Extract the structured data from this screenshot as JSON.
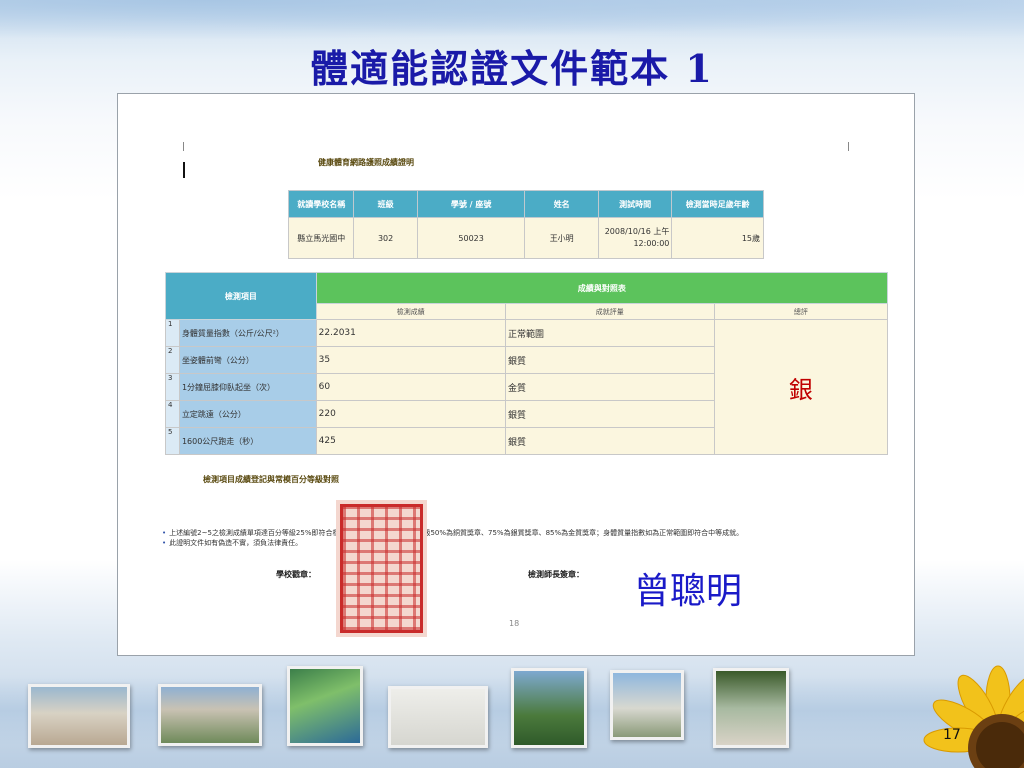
{
  "slide": {
    "title": "體適能認證文件範本 1",
    "slide_number": "17"
  },
  "document": {
    "title": "健康體育網路護照成績證明",
    "student_table": {
      "headers": [
        "就讀學校名稱",
        "班級",
        "學號 / 座號",
        "姓名",
        "測試時間",
        "檢測當時足歲年齡"
      ],
      "values": [
        "縣立馬光國中",
        "302",
        "50023",
        "王小明",
        "2008/10/16 上午 12:00:00",
        "15歲"
      ]
    },
    "results_table": {
      "item_header": "檢測項目",
      "score_header": "成績與對照表",
      "sub_headers": [
        "檢測成績",
        "成就評量",
        "總評"
      ],
      "rows": [
        {
          "no": "1",
          "item": "身體質量指數（公斤/公尺²）",
          "score": "22.2031",
          "rating": "正常範圍"
        },
        {
          "no": "2",
          "item": "坐姿體前彎（公分）",
          "score": "35",
          "rating": "銀質"
        },
        {
          "no": "3",
          "item": "1分鐘屈膝仰臥起坐（次）",
          "score": "60",
          "rating": "金質"
        },
        {
          "no": "4",
          "item": "立定跳遠（公分）",
          "score": "220",
          "rating": "銀質"
        },
        {
          "no": "5",
          "item": "1600公尺跑走（秒）",
          "score": "425",
          "rating": "銀質"
        }
      ],
      "overall": "銀"
    },
    "section2_title": "檢測項目成績登記與常模百分等級對照",
    "notes": [
      "上述編號2~5之檢測成績單項達百分等級25%即符合標準成就，各項成績達百分等級50%為銅質獎章、75%為銀質獎章、85%為金質獎章；身體質量指數如為正常範圍即符合中等成就。",
      "此證明文件如有偽造不實，須負法律責任。"
    ],
    "school_seal_label": "學校戳章：",
    "director_sign_label": "檢測師長簽章：",
    "signature": "曾聰明",
    "page_number": "18"
  },
  "colors": {
    "title": "#1a1aa8",
    "header_blue": "#4bacc6",
    "header_green": "#5cc35c",
    "cell_cream": "#fbf6df",
    "item_blue": "#a8cde8",
    "medal_red": "#c00000",
    "signature_blue": "#1a1ac8",
    "seal_red": "#c92a2a"
  }
}
